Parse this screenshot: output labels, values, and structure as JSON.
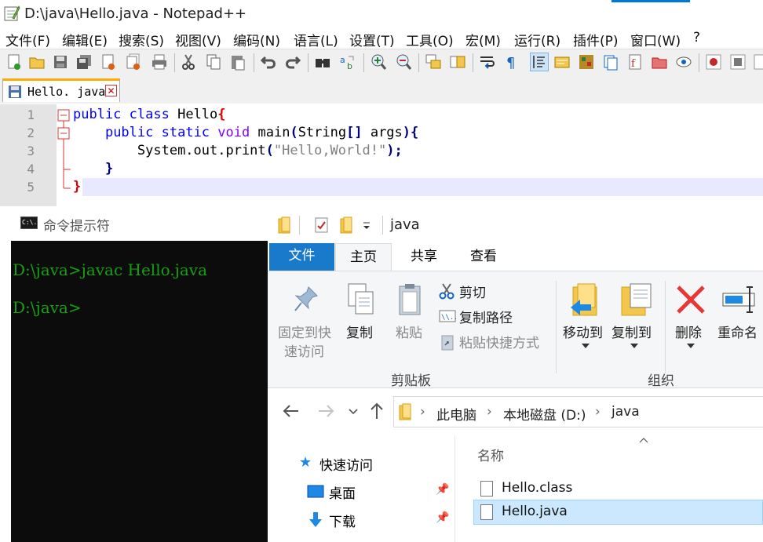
{
  "notepad": {
    "title": "D:\\java\\Hello.java - Notepad++",
    "menu": [
      "文件(F)",
      "编辑(E)",
      "搜索(S)",
      "视图(V)",
      "编码(N)",
      "语言(L)",
      "设置(T)",
      "工具(O)",
      "宏(M)",
      "运行(R)",
      "插件(P)",
      "窗口(W)",
      "?"
    ],
    "tab": {
      "name": "Hello. java",
      "close": "✕"
    },
    "line_numbers": [
      "1",
      "2",
      "3",
      "4",
      "5"
    ],
    "code": {
      "l1_kw1": "public",
      "l1_kw2": "class",
      "l1_name": " Hello",
      "l1_brace": "{",
      "l2_indent": "    ",
      "l2_kw1": "public",
      "l2_kw2": "static",
      "l2_kw3": "void",
      "l2_name": " main",
      "l2_open": "(",
      "l2_type": "String",
      "l2_arr": "[]",
      "l2_arg": " args",
      "l2_close": ")",
      "l2_brace": "{",
      "l3_indent": "        ",
      "l3_call": "System.out.print",
      "l3_open": "(",
      "l3_str": "\"Hello,World!\"",
      "l3_close": ");",
      "l4_indent": "    ",
      "l4_brace": "}",
      "l5_brace": "}"
    }
  },
  "cmd": {
    "title": "命令提示符",
    "icon_text": "C:\\.",
    "line1": "D:\\java>javac Hello.java",
    "line2": "D:\\java>"
  },
  "explorer": {
    "title": "java",
    "tabs": {
      "file": "文件",
      "home": "主页",
      "share": "共享",
      "view": "查看"
    },
    "ribbon": {
      "pin": [
        "固定到快",
        "速访问"
      ],
      "copy": "复制",
      "paste": "粘贴",
      "cut": "剪切",
      "copy_path": "复制路径",
      "paste_shortcut": "粘贴快捷方式",
      "clipboard_group": "剪贴板",
      "move_to": "移动到",
      "copy_to": "复制到",
      "delete": "删除",
      "rename": "重命名",
      "organize_group": "组织"
    },
    "breadcrumb": [
      "此电脑",
      "本地磁盘 (D:)",
      "java"
    ],
    "nav": {
      "quick_access": "快速访问",
      "desktop": "桌面",
      "downloads": "下载"
    },
    "column_header": "名称",
    "files": [
      "Hello.class",
      "Hello.java"
    ]
  }
}
